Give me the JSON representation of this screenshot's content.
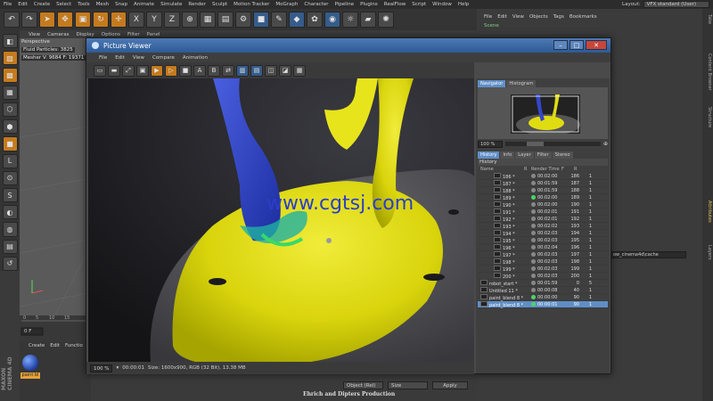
{
  "app": {
    "menu": [
      "File",
      "Edit",
      "Create",
      "Select",
      "Tools",
      "Mesh",
      "Snap",
      "Animate",
      "Simulate",
      "Render",
      "Sculpt",
      "Motion Tracker",
      "MoGraph",
      "Character",
      "Pipeline",
      "Plugins",
      "RealFlow",
      "Script",
      "Window",
      "Help"
    ],
    "layout_label": "Layout:",
    "layout_value": "VFX standard (User)"
  },
  "viewport": {
    "menu": [
      "View",
      "Cameras",
      "Display",
      "Options",
      "Filter",
      "Panel"
    ],
    "label": "Perspective",
    "hud_particles": "Fluid Particles: 3825",
    "hud_mesher": "Mesher V: 9684 F: 19371",
    "frame_field": "0 F"
  },
  "object_manager": {
    "menu": [
      "File",
      "Edit",
      "View",
      "Objects",
      "Tags",
      "Bookmarks"
    ],
    "scene": "Scene"
  },
  "material_manager": {
    "menu": [
      "Create",
      "Edit",
      "Functio"
    ],
    "material_name": "paint bl"
  },
  "brand": "MAXON CINEMA 4D",
  "cache_path": "ow_cinema4d\\cache",
  "bottom": {
    "object_rel": "Object (Rel)",
    "size": "Size",
    "apply": "Apply",
    "credit": "Ehrich  and  Dipters  Production"
  },
  "side_tabs": [
    "Take",
    "Content Browser",
    "Structure",
    "Attributes",
    "Layers"
  ],
  "picture_viewer": {
    "title": "Picture Viewer",
    "menu": [
      "File",
      "Edit",
      "View",
      "Compare",
      "Animation"
    ],
    "watermark": "www.cgtsj.com",
    "status": {
      "zoom": "100 %",
      "time": "00:00:01",
      "info": "Size: 1600x900, RGB (32 Bit), 13.38 MB"
    },
    "tabs_top": [
      "Navigator",
      "Histogram"
    ],
    "nav_zoom": "100 %",
    "tabs_mid": [
      "History",
      "Info",
      "Layer",
      "Filter",
      "Stereo"
    ],
    "history_title": "History",
    "columns": [
      "Name",
      "R",
      "Render Time",
      "F",
      "R"
    ],
    "rows": [
      {
        "name": "186 *",
        "time": "00:02:00",
        "f": "186",
        "r": "1",
        "green": false
      },
      {
        "name": "187 *",
        "time": "00:01:59",
        "f": "187",
        "r": "1",
        "green": false
      },
      {
        "name": "188 *",
        "time": "00:01:59",
        "f": "188",
        "r": "1",
        "green": false
      },
      {
        "name": "189 *",
        "time": "00:02:00",
        "f": "189",
        "r": "1",
        "green": true
      },
      {
        "name": "190 *",
        "time": "00:02:00",
        "f": "190",
        "r": "1",
        "green": false
      },
      {
        "name": "191 *",
        "time": "00:02:01",
        "f": "191",
        "r": "1",
        "green": false
      },
      {
        "name": "192 *",
        "time": "00:02:01",
        "f": "192",
        "r": "1",
        "green": false
      },
      {
        "name": "193 *",
        "time": "00:02:02",
        "f": "193",
        "r": "1",
        "green": false
      },
      {
        "name": "194 *",
        "time": "00:02:03",
        "f": "194",
        "r": "1",
        "green": false
      },
      {
        "name": "195 *",
        "time": "00:02:03",
        "f": "195",
        "r": "1",
        "green": false
      },
      {
        "name": "196 *",
        "time": "00:02:04",
        "f": "196",
        "r": "1",
        "green": false
      },
      {
        "name": "197 *",
        "time": "00:02:03",
        "f": "197",
        "r": "1",
        "green": false
      },
      {
        "name": "198 *",
        "time": "00:02:03",
        "f": "198",
        "r": "1",
        "green": false
      },
      {
        "name": "199 *",
        "time": "00:02:03",
        "f": "199",
        "r": "1",
        "green": false
      },
      {
        "name": "200 *",
        "time": "00:02:03",
        "f": "200",
        "r": "1",
        "green": false
      }
    ],
    "top_rows": [
      {
        "name": "robot_start *",
        "time": "00:01:59",
        "f": "0",
        "r": "5",
        "green": false,
        "sel": false
      },
      {
        "name": "Untitled 11 *",
        "time": "00:00:08",
        "f": "40",
        "r": "1",
        "green": false,
        "sel": false
      },
      {
        "name": "paint_blend 8 *",
        "time": "00:00:00",
        "f": "90",
        "r": "1",
        "green": true,
        "sel": false
      },
      {
        "name": "paint_blend 8 *",
        "time": "00:00:01",
        "f": "90",
        "r": "1",
        "green": true,
        "sel": true
      }
    ]
  },
  "colors": {
    "accent": "#5f8ec7",
    "title": "#3d6aa5",
    "fluid_yellow": "#e6e20f",
    "fluid_blue": "#2f44c8"
  }
}
